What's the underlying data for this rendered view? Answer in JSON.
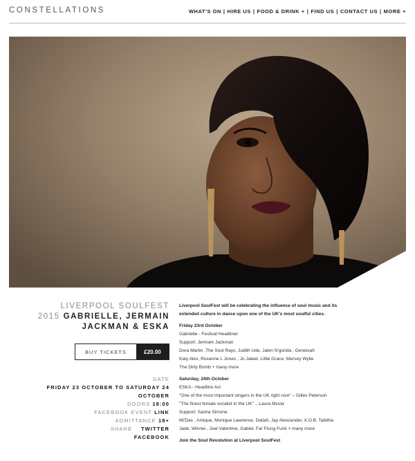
{
  "header": {
    "logo": "CONSTELLATIONS",
    "nav": [
      {
        "label": "WHAT'S ON"
      },
      {
        "label": "HIRE US"
      },
      {
        "label": "FOOD & DRINK +"
      },
      {
        "label": "FIND US"
      },
      {
        "label": "CONTACT US"
      },
      {
        "label": "MORE +"
      }
    ],
    "separator": "|"
  },
  "event": {
    "title_light_1": "LIVERPOOL SOULFEST",
    "title_light_2": "2015",
    "title_bold_1": "GABRIELLE, JERMAIN",
    "title_bold_2": "JACKMAN & ESKA",
    "buy_label": "BUY TICKETS",
    "price": "£20.00",
    "date_label": "DATE",
    "date_value_1": "FRIDAY 23 OCTOBER TO SATURDAY 24",
    "date_value_2": "OCTOBER",
    "doors_label": "DOORS",
    "doors_value": "18:00",
    "facebook_label": "FACEBOOK EVENT",
    "facebook_link": "LINK",
    "admittance_label": "ADMITTANCE",
    "admittance_value": "18+",
    "share_label": "SHARE",
    "share_twitter": "TWITTER",
    "share_facebook": "FACEBOOK"
  },
  "description": {
    "intro_1": "Liverpool SoulFest will be celebrating the influence of soul music and its",
    "intro_2": "extended culture in dance upon one of the UK's most soulful cities.",
    "friday_heading": "Friday 23rd October",
    "friday_lines": [
      "Gabrielle - Festival Headliner",
      "Support: Jermain Jackman",
      "Dora Martin ,The Soul Rays, Judith Ude, Jalen N'gonda , Geneivah",
      "Katy Alex, Roxanne L Jones , Jo Jaleel, Little Grace, Mersey Wylie",
      "The Dirty Bomb + many more"
    ],
    "saturday_heading": "Saturday, 24th October",
    "saturday_lines": [
      "ESKA - Headline Act",
      "\"One of the most important singers in the UK right now\" – Gilles Peterson",
      "\"The finest female vocalist in the UK\" ...Laura Mvula",
      "Support: Sasha Simone",
      "Mi'Das , Amique, Monique Lawrence, Deliah, Jay Alexzander, A.O.B. Tabitha",
      "Jade, Winnie , Joel Valentine, Gabiel, Far Flung Funk + many more"
    ],
    "closing": "Join the Soul Revolution at Liverpool SoulFest"
  }
}
